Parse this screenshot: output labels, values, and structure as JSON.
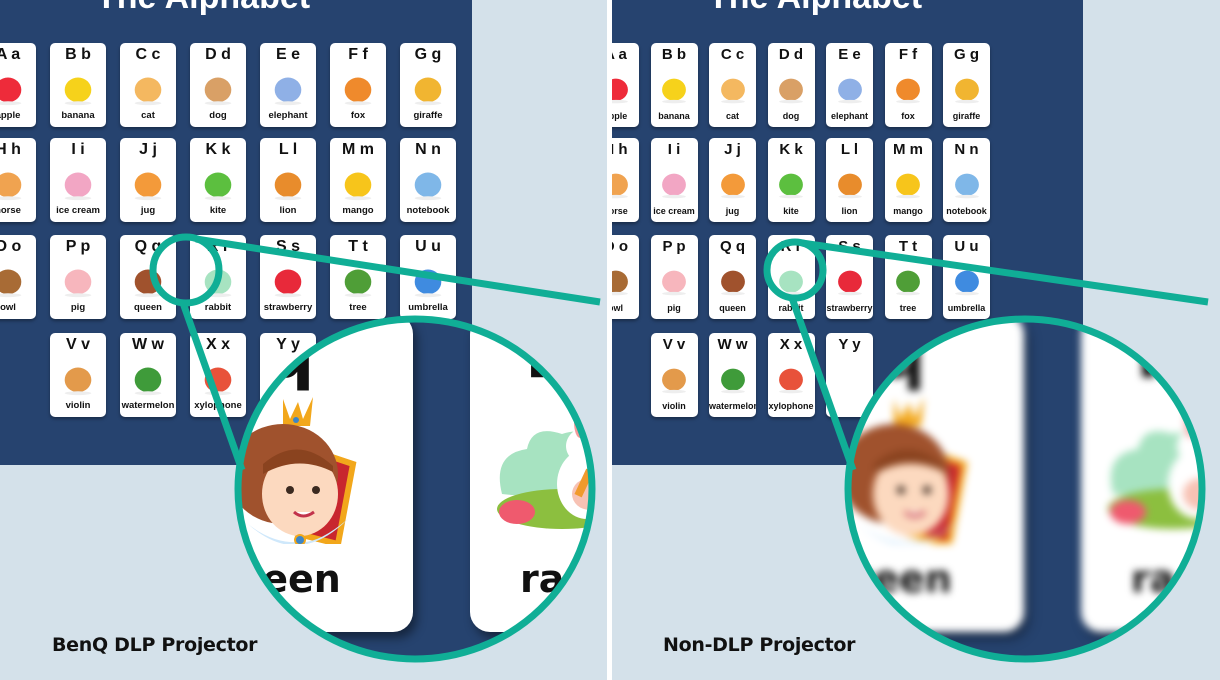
{
  "board": {
    "title": "The Alphabet",
    "cards": [
      {
        "letters": "A a",
        "word": "apple",
        "icon": "apple-icon",
        "color": "#ee2b3a"
      },
      {
        "letters": "B b",
        "word": "banana",
        "icon": "banana-icon",
        "color": "#f6d21b"
      },
      {
        "letters": "C c",
        "word": "cat",
        "icon": "cat-icon",
        "color": "#f4b860"
      },
      {
        "letters": "D d",
        "word": "dog",
        "icon": "dog-icon",
        "color": "#d9a066"
      },
      {
        "letters": "E e",
        "word": "elephant",
        "icon": "elephant-icon",
        "color": "#8fb0e6"
      },
      {
        "letters": "F f",
        "word": "fox",
        "icon": "fox-icon",
        "color": "#ef8a2c"
      },
      {
        "letters": "G g",
        "word": "giraffe",
        "icon": "giraffe-icon",
        "color": "#f1b531"
      },
      {
        "letters": "H h",
        "word": "horse",
        "icon": "horse-icon",
        "color": "#f0a350"
      },
      {
        "letters": "I i",
        "word": "ice cream",
        "icon": "ice-cream-icon",
        "color": "#f2a6c4"
      },
      {
        "letters": "J j",
        "word": "jug",
        "icon": "jug-icon",
        "color": "#f39a3a"
      },
      {
        "letters": "K k",
        "word": "kite",
        "icon": "kite-icon",
        "color": "#5cbf3f"
      },
      {
        "letters": "L l",
        "word": "lion",
        "icon": "lion-icon",
        "color": "#e88c2c"
      },
      {
        "letters": "M m",
        "word": "mango",
        "icon": "mango-icon",
        "color": "#f7c51b"
      },
      {
        "letters": "N n",
        "word": "notebook",
        "icon": "notebook-icon",
        "color": "#7fb7e8"
      },
      {
        "letters": "O o",
        "word": "owl",
        "icon": "owl-icon",
        "color": "#a86b35"
      },
      {
        "letters": "P p",
        "word": "pig",
        "icon": "pig-icon",
        "color": "#f7b6bd"
      },
      {
        "letters": "Q q",
        "word": "queen",
        "icon": "queen-icon",
        "color": "#a0522d"
      },
      {
        "letters": "R r",
        "word": "rabbit",
        "icon": "rabbit-icon",
        "color": "#a7e3c1"
      },
      {
        "letters": "S s",
        "word": "strawberry",
        "icon": "strawberry-icon",
        "color": "#e8293a"
      },
      {
        "letters": "T t",
        "word": "tree",
        "icon": "tree-icon",
        "color": "#4f9e37"
      },
      {
        "letters": "U u",
        "word": "umbrella",
        "icon": "umbrella-icon",
        "color": "#3f8be0"
      },
      {
        "letters": "V v",
        "word": "violin",
        "icon": "violin-icon",
        "color": "#e39a4b"
      },
      {
        "letters": "W w",
        "word": "watermelon",
        "icon": "watermelon-icon",
        "color": "#3f9b3a"
      },
      {
        "letters": "X x",
        "word": "xylophone",
        "icon": "xylophone-icon",
        "color": "#e8523a"
      },
      {
        "letters": "Y y",
        "word": "",
        "icon": "",
        "color": "#ffffff"
      }
    ]
  },
  "magnifier": {
    "card_left": {
      "letters": "Q q",
      "word": "queen",
      "icon": "queen-icon"
    },
    "card_right": {
      "letters": "R r",
      "word": "ra",
      "icon": "rabbit-icon"
    }
  },
  "panels": {
    "left": {
      "caption": "BenQ DLP Projector"
    },
    "right": {
      "caption": "Non-DLP Projector"
    }
  },
  "colors": {
    "board": "#26436f",
    "background": "#d4e1ea",
    "magnifier_ring": "#10ae96"
  }
}
